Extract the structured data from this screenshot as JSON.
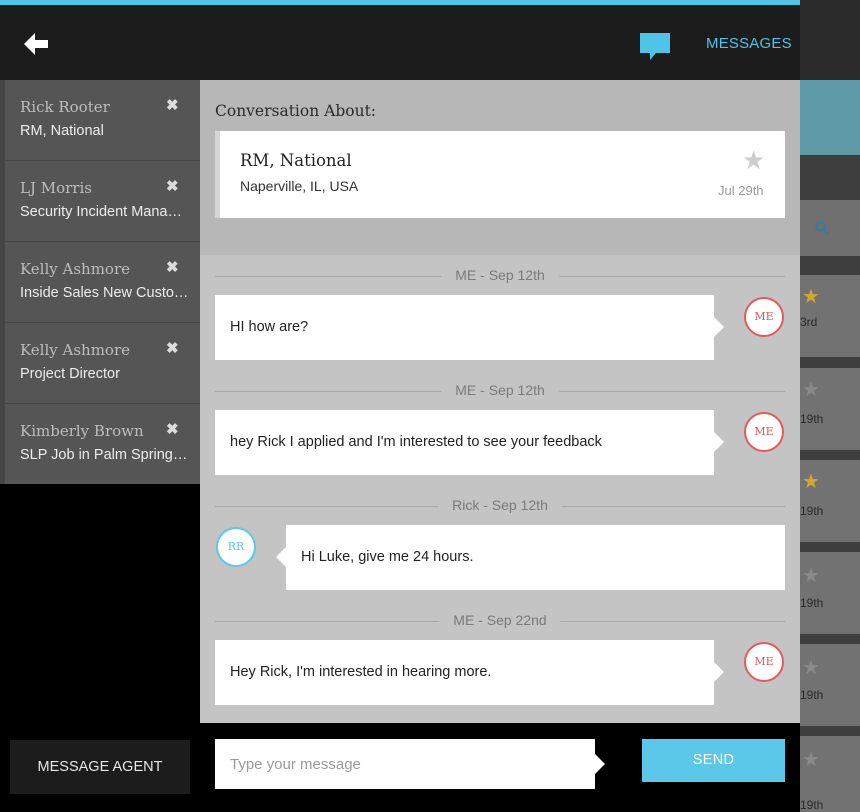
{
  "header": {
    "back_icon": "back-arrow-icon",
    "chat_icon": "chat-bubble-icon",
    "messages_label": "MESSAGES",
    "menu_icon": "hamburger-menu-icon",
    "accent_color": "#4fc3e8"
  },
  "sidebar": {
    "items": [
      {
        "name": "Rick Rooter",
        "subtitle": "RM, National"
      },
      {
        "name": "LJ Morris",
        "subtitle": "Security Incident Mana…"
      },
      {
        "name": "Kelly Ashmore",
        "subtitle": "Inside Sales New Custo…"
      },
      {
        "name": "Kelly Ashmore",
        "subtitle": "Project Director"
      },
      {
        "name": "Kimberly Brown",
        "subtitle": "SLP Job in Palm Spring…"
      }
    ],
    "close_icon": "close-x-icon",
    "message_agent_label": "MESSAGE AGENT"
  },
  "conversation": {
    "about_label": "Conversation About:",
    "job": {
      "title": "RM, National",
      "location": "Naperville, IL, USA",
      "date": "Jul 29th",
      "favorited": false
    }
  },
  "messages": [
    {
      "separator": "ME - Sep 12th",
      "text": "HI how are?",
      "sender": "me",
      "avatar": "ME"
    },
    {
      "separator": "ME - Sep 12th",
      "text": "hey Rick I applied and I'm interested to see your feedback",
      "sender": "me",
      "avatar": "ME"
    },
    {
      "separator": "Rick - Sep 12th",
      "text": "Hi Luke, give me 24 hours.",
      "sender": "them",
      "avatar": "RR"
    },
    {
      "separator": "ME - Sep 22nd",
      "text": "Hey Rick, I'm interested in hearing more.",
      "sender": "me",
      "avatar": "ME"
    }
  ],
  "composer": {
    "placeholder": "Type your message",
    "value": "",
    "send_label": "SEND"
  },
  "background_list": {
    "dates": [
      "3rd",
      "19th",
      "19th",
      "19th",
      "19th",
      "19th"
    ],
    "starred": [
      true,
      false,
      true,
      false,
      false,
      false
    ]
  },
  "colors": {
    "me_avatar": "#e55a58",
    "them_avatar": "#5ac8ea",
    "send_button": "#5bc8ea"
  }
}
